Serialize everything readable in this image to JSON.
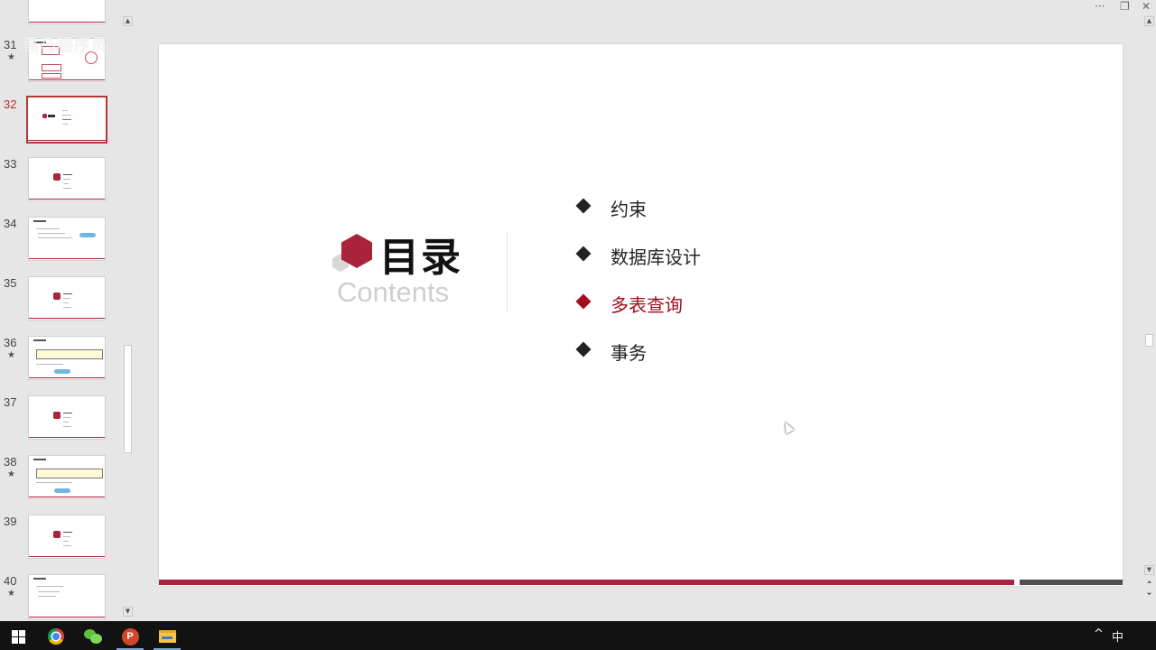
{
  "watermark": "黑马程序员",
  "thumbnails": [
    {
      "number": "31",
      "starred": true,
      "active": false
    },
    {
      "number": "32",
      "starred": false,
      "active": true
    },
    {
      "number": "33",
      "starred": false,
      "active": false
    },
    {
      "number": "34",
      "starred": false,
      "active": false
    },
    {
      "number": "35",
      "starred": false,
      "active": false
    },
    {
      "number": "36",
      "starred": true,
      "active": false
    },
    {
      "number": "37",
      "starred": false,
      "active": false
    },
    {
      "number": "38",
      "starred": true,
      "active": false
    },
    {
      "number": "39",
      "starred": false,
      "active": false
    },
    {
      "number": "40",
      "starred": true,
      "active": false
    }
  ],
  "star_glyph": "★",
  "slide": {
    "title": "目录",
    "subtitle": "Contents",
    "toc": [
      {
        "label": "约束",
        "active": false
      },
      {
        "label": "数据库设计",
        "active": false
      },
      {
        "label": "多表查询",
        "active": true
      },
      {
        "label": "事务",
        "active": false
      }
    ],
    "accent_color": "#a9233a",
    "secondary_bar_color": "#505050"
  },
  "window_controls": {
    "more": "···",
    "restore": "❐",
    "close": "✕"
  },
  "taskbar": {
    "apps": [
      "windows-start",
      "chrome",
      "wechat",
      "powerpoint",
      "file-explorer"
    ],
    "ppt_letter": "P",
    "tray_chevron": "^",
    "ime": "中"
  }
}
